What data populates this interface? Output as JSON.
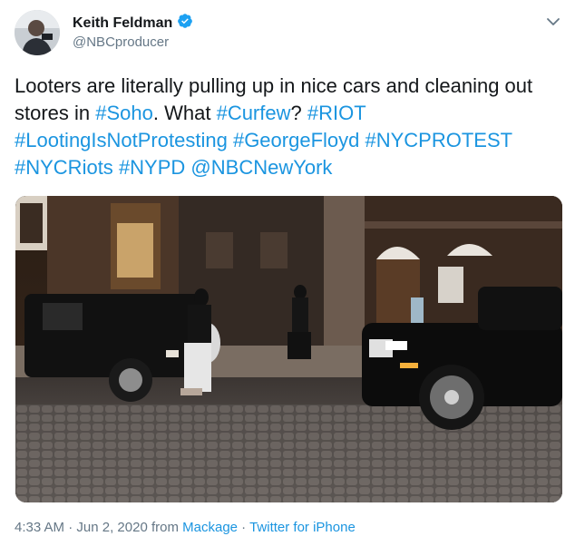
{
  "author": {
    "display_name": "Keith Feldman",
    "handle": "@NBCproducer",
    "verified": true
  },
  "tweet_text": {
    "line1_text": "Looters are literally pulling up in nice cars and cleaning out stores in ",
    "hashtag_soho": "#Soho",
    "mid_text": ". What ",
    "hashtag_curfew": "#Curfew",
    "q_text": "? ",
    "hashtag_riot": "#RIOT",
    "hashtag_looting": "#LootingIsNotProtesting",
    "hashtag_floyd": "#GeorgeFloyd",
    "hashtag_nycprotest": "#NYCPROTEST",
    "hashtag_nycriots": "#NYCRiots",
    "hashtag_nypd": "#NYPD",
    "mention_nbc": "@NBCNewYork"
  },
  "meta": {
    "time": "4:33 AM",
    "separator1": " · ",
    "date": "Jun 2, 2020",
    "from_text": " from ",
    "location": "Mackage",
    "separator2": " · ",
    "source": "Twitter for iPhone"
  },
  "colors": {
    "link": "#1b95e0",
    "secondary": "#657786",
    "verified": "#1da1f2"
  },
  "icons": {
    "caret": "chevron-down-icon",
    "verified": "verified-badge-icon"
  }
}
